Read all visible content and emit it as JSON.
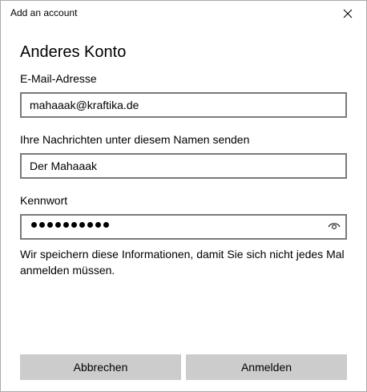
{
  "window": {
    "title": "Add an account",
    "close_icon": "close-icon"
  },
  "form": {
    "heading": "Anderes Konto",
    "email": {
      "label": "E-Mail-Adresse",
      "value": "mahaaak@kraftika.de"
    },
    "display_name": {
      "label": "Ihre Nachrichten unter diesem Namen senden",
      "value": "Der Mahaaak"
    },
    "password": {
      "label": "Kennwort",
      "masked_length": 10,
      "reveal_icon": "eye-icon"
    },
    "info_text": "Wir speichern diese Informationen, damit Sie sich nicht jedes Mal anmelden müssen."
  },
  "buttons": {
    "cancel_label": "Abbrechen",
    "signin_label": "Anmelden"
  },
  "colors": {
    "field_border": "#7a7a7a",
    "button_bg": "#cccccc"
  }
}
